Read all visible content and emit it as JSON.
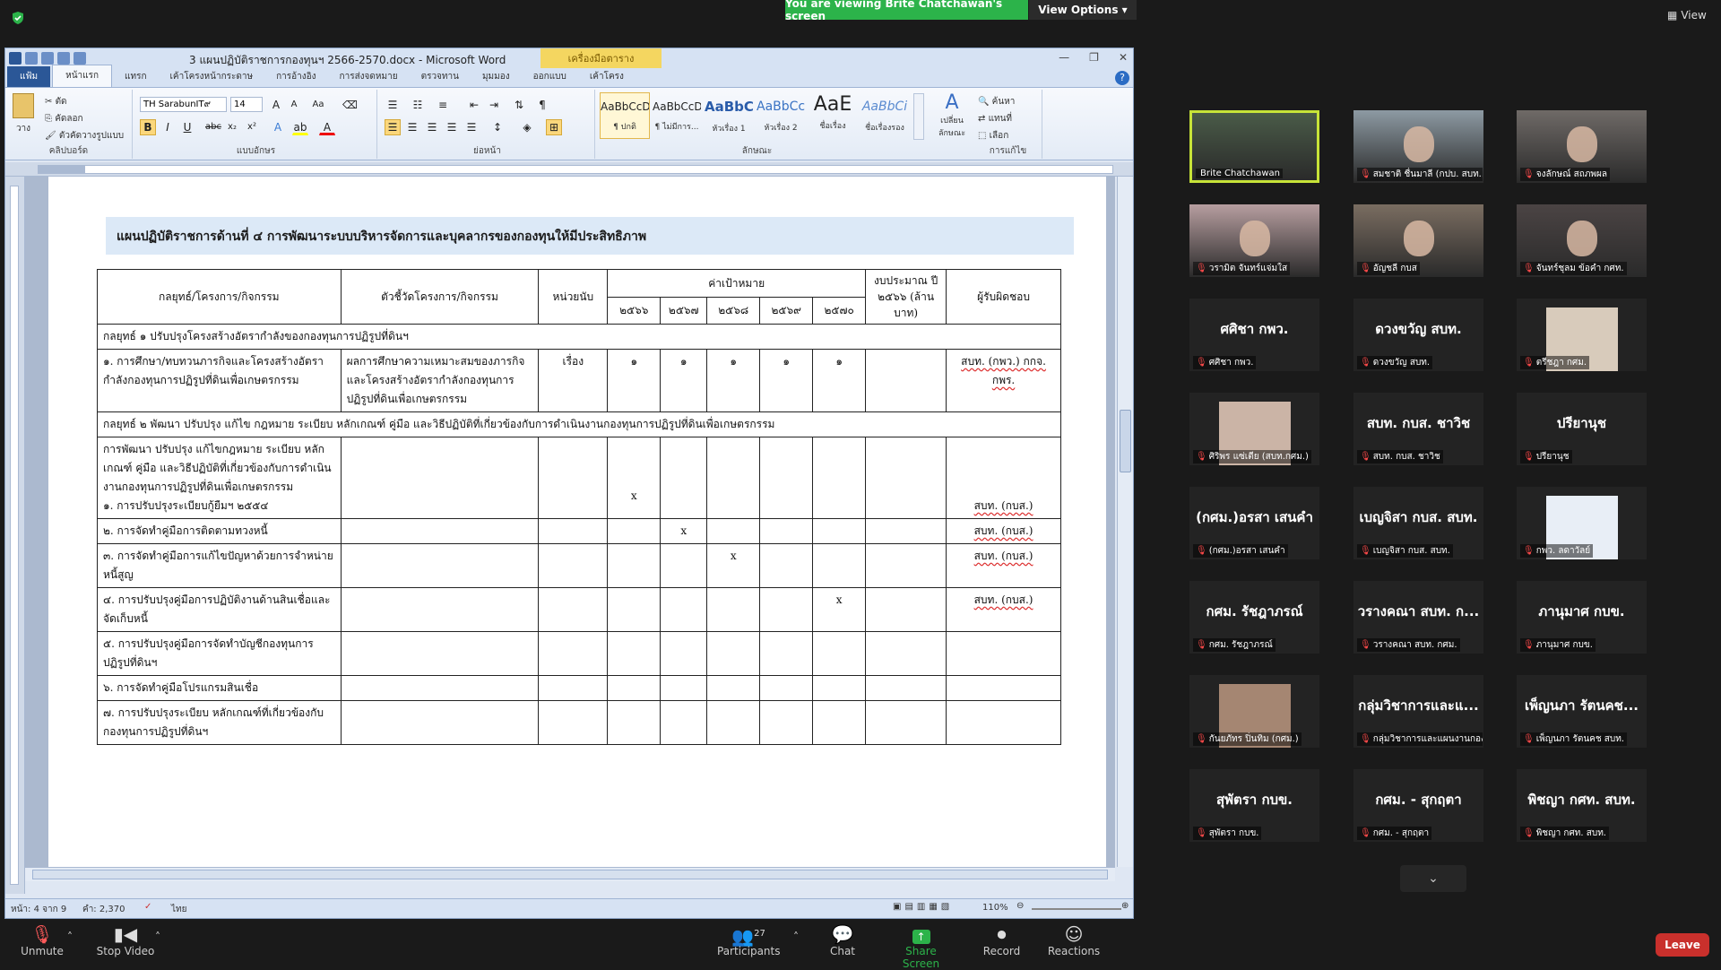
{
  "zoom": {
    "banner": "You are viewing Brite Chatchawan's screen",
    "view_options": "View Options",
    "view": "View"
  },
  "word": {
    "title": "3 แผนปฏิบัติราชการกองทุนฯ 2566-2570.docx - Microsoft Word",
    "tool_tab": "เครื่องมือตาราง",
    "tabs": [
      "แฟ้ม",
      "หน้าแรก",
      "แทรก",
      "เค้าโครงหน้ากระดาษ",
      "การอ้างอิง",
      "การส่งจดหมาย",
      "ตรวจทาน",
      "มุมมอง",
      "ออกแบบ",
      "เค้าโครง"
    ],
    "ribbon": {
      "paste": "วาง",
      "cut": "ตัด",
      "copy": "คัดลอก",
      "format_painter": "ตัวคัดวางรูปแบบ",
      "clipboard": "คลิปบอร์ด",
      "font_name": "TH SarabunIT๙",
      "font_size": "14",
      "font_group": "แบบอักษร",
      "paragraph_group": "ย่อหน้า",
      "styles_group": "ลักษณะ",
      "editing_group": "การแก้ไข",
      "change_styles": "เปลี่ยนลักษณะ",
      "find": "ค้นหา",
      "replace": "แทนที่",
      "select": "เลือก",
      "styles": [
        {
          "sample": "AaBbCcDc",
          "label": "¶ ปกติ"
        },
        {
          "sample": "AaBbCcDc",
          "label": "¶ ไม่มีการ..."
        },
        {
          "sample": "AaBbC",
          "label": "หัวเรื่อง 1"
        },
        {
          "sample": "AaBbCc",
          "label": "หัวเรื่อง 2"
        },
        {
          "sample": "AaE",
          "label": "ชื่อเรื่อง"
        },
        {
          "sample": "AaBbCi",
          "label": "ชื่อเรื่องรอง"
        }
      ]
    },
    "status": {
      "page": "หน้า: 4 จาก 9",
      "words": "คำ: 2,370",
      "lang": "ไทย",
      "zoom": "110%"
    }
  },
  "document": {
    "heading": "แผนปฏิบัติราชการด้านที่ ๔ การพัฒนาระบบบริหารจัดการและบุคลากรของกองทุนให้มีประสิทธิภาพ",
    "headers": {
      "strategy": "กลยุทธ์/โครงการ/กิจกรรม",
      "indicator": "ตัวชี้วัดโครงการ/กิจกรรม",
      "unit": "หน่วยนับ",
      "target": "ค่าเป้าหมาย",
      "years": [
        "๒๕๖๖",
        "๒๕๖๗",
        "๒๕๖๘",
        "๒๕๖๙",
        "๒๕๗๐"
      ],
      "budget": "งบประมาณ ปี ๒๕๖๖ (ล้านบาท)",
      "responsible": "ผู้รับผิดชอบ"
    },
    "strategy1": "กลยุทธ์ ๑ ปรับปรุงโครงสร้างอัตรากำลังของกองทุนการปฏิรูปที่ดินฯ",
    "row1": {
      "activity": "๑. การศึกษา/ทบทวนภารกิจและโครงสร้างอัตรากำลังกองทุนการปฏิรูปที่ดินเพื่อเกษตรกรรม",
      "indicator": "ผลการศึกษาความเหมาะสมของภารกิจและโครงสร้างอัตรากำลังกองทุนการปฏิรูปที่ดินเพื่อเกษตรกรรม",
      "unit": "เรื่อง",
      "targets": [
        "๑",
        "๑",
        "๑",
        "๑",
        "๑"
      ],
      "responsible": "สบท. (กพว.) กกจ. กพร."
    },
    "strategy2": "กลยุทธ์ ๒ พัฒนา ปรับปรุง แก้ไข กฎหมาย ระเบียบ หลักเกณฑ์ คู่มือ และวิธีปฏิบัติที่เกี่ยวข้องกับการดำเนินงานกองทุนการปฏิรูปที่ดินเพื่อเกษตรกรรม",
    "group2_title": "การพัฒนา ปรับปรุง แก้ไขกฎหมาย ระเบียบ หลักเกณฑ์ คู่มือ และวิธีปฏิบัติที่เกี่ยวข้องกับการดำเนินงานกองทุนการปฏิรูปที่ดินเพื่อเกษตรกรรม",
    "rows2": [
      {
        "activity": "๑. การปรับปรุงระเบียบกู้ยืมฯ ๒๕๕๔",
        "mark": "x",
        "year": 0,
        "responsible": "สบท. (กบส.)"
      },
      {
        "activity": "๒. การจัดทำคู่มือการติดตามทวงหนี้",
        "mark": "x",
        "year": 1,
        "responsible": "สบท. (กบส.)"
      },
      {
        "activity": "๓. การจัดทำคู่มือการแก้ไขปัญหาด้วยการจำหน่ายหนี้สูญ",
        "mark": "x",
        "year": 2,
        "responsible": "สบท. (กบส.)"
      },
      {
        "activity": "๔. การปรับปรุงคู่มือการปฏิบัติงานด้านสินเชื่อและจัดเก็บหนี้",
        "mark": "x",
        "year": 4,
        "responsible": "สบท. (กบส.)"
      },
      {
        "activity": "๕. การปรับปรุงคู่มือการจัดทำบัญชีกองทุนการปฏิรูปที่ดินฯ",
        "mark": "",
        "year": -1,
        "responsible": ""
      },
      {
        "activity": "๖. การจัดทำคู่มือโปรแกรมสินเชื่อ",
        "mark": "",
        "year": -1,
        "responsible": ""
      },
      {
        "activity": "๗. การปรับปรุงระเบียบ หลักเกณฑ์ที่เกี่ยวข้องกับกองทุนการปฏิรูปที่ดินฯ",
        "mark": "",
        "year": -1,
        "responsible": ""
      }
    ]
  },
  "participants": [
    {
      "big": "",
      "label": "Brite Chatchawan",
      "video": true,
      "muted": false,
      "active": true,
      "bg": "#4a5b48"
    },
    {
      "big": "",
      "label": "สมชาติ ชื่นมาลี (กปบ. สบท...",
      "video": true,
      "muted": true,
      "active": false,
      "bg": "#8d9aa3"
    },
    {
      "big": "",
      "label": "จงลักษณ์ สถภพผล",
      "video": true,
      "muted": true,
      "active": false,
      "bg": "#6f6a67"
    },
    {
      "big": "",
      "label": "วรามิต จันทร์แจ่มใส",
      "video": true,
      "muted": true,
      "active": false,
      "bg": "#b79ea0"
    },
    {
      "big": "",
      "label": "อัญชลี กบส",
      "video": true,
      "muted": true,
      "active": false,
      "bg": "#7a6d61"
    },
    {
      "big": "",
      "label": "จันทร์ชุลม ข้อคำ กศท.",
      "video": true,
      "muted": true,
      "active": false,
      "bg": "#4b4444"
    },
    {
      "big": "ศศิชา กพว.",
      "label": "ศศิชา กพว.",
      "video": false,
      "muted": true,
      "active": false,
      "bg": ""
    },
    {
      "big": "ดวงขวัญ สบท.",
      "label": "ดวงขวัญ สบท.",
      "video": false,
      "muted": true,
      "active": false,
      "bg": ""
    },
    {
      "big": "",
      "label": "ตรีชฎา กศม.",
      "video": false,
      "muted": true,
      "active": false,
      "bg": "",
      "thumb": "#d8cbbb"
    },
    {
      "big": "",
      "label": "ศิริพร แซ่เตีย (สบท.กศม.)",
      "video": false,
      "muted": true,
      "active": false,
      "bg": "",
      "thumb": "#cbb4a6"
    },
    {
      "big": "สบท. กบส. ชาวิช",
      "label": "สบท. กบส. ชาวิช",
      "video": false,
      "muted": true,
      "active": false,
      "bg": ""
    },
    {
      "big": "ปรียานุช",
      "label": "ปรียานุช",
      "video": false,
      "muted": true,
      "active": false,
      "bg": ""
    },
    {
      "big": "(กศม.)อรสา เสนคำ",
      "label": "(กศม.)อรสา เสนคำ",
      "video": false,
      "muted": true,
      "active": false,
      "bg": ""
    },
    {
      "big": "เบญจิสา กบส. สบท.",
      "label": "เบญจิสา กบส. สบท.",
      "video": false,
      "muted": true,
      "active": false,
      "bg": ""
    },
    {
      "big": "",
      "label": "กพว. ลดาวัลย์",
      "video": false,
      "muted": true,
      "active": false,
      "bg": "",
      "thumb": "#e8eef6"
    },
    {
      "big": "กศม. รัชฎาภรณ์",
      "label": "กศม. รัชฎาภรณ์",
      "video": false,
      "muted": true,
      "active": false,
      "bg": ""
    },
    {
      "big": "วรางคณา สบท. ก...",
      "label": "วรางคณา สบท. กศม.",
      "video": false,
      "muted": true,
      "active": false,
      "bg": ""
    },
    {
      "big": "ภานุมาศ กบข.",
      "label": "ภานุมาศ กบข.",
      "video": false,
      "muted": true,
      "active": false,
      "bg": ""
    },
    {
      "big": "",
      "label": "กันยภัทร ปิ่นทิม (กศม.)",
      "video": false,
      "muted": true,
      "active": false,
      "bg": "",
      "thumb": "#a58672"
    },
    {
      "big": "กลุ่มวิชาการและแ...",
      "label": "กลุ่มวิชาการและแผนงานกอง...",
      "video": false,
      "muted": true,
      "active": false,
      "bg": ""
    },
    {
      "big": "เพ็ญนภา รัตนคช...",
      "label": "เพ็ญนภา รัตนคช สบท.",
      "video": false,
      "muted": true,
      "active": false,
      "bg": ""
    },
    {
      "big": "สุพัตรา กบข.",
      "label": "สุพัตรา กบข.",
      "video": false,
      "muted": true,
      "active": false,
      "bg": ""
    },
    {
      "big": "กศม. - สุกฤตา",
      "label": "กศม. - สุกฤตา",
      "video": false,
      "muted": true,
      "active": false,
      "bg": ""
    },
    {
      "big": "พิชญา กศท. สบท.",
      "label": "พิชญา กศท. สบท.",
      "video": false,
      "muted": true,
      "active": false,
      "bg": ""
    }
  ],
  "toolbar": {
    "unmute": "Unmute",
    "stop_video": "Stop Video",
    "participants": "Participants",
    "participants_count": "27",
    "chat": "Chat",
    "share": "Share Screen",
    "record": "Record",
    "reactions": "Reactions",
    "leave": "Leave"
  },
  "colors": {
    "share_green": "#2cb34a",
    "leave_red": "#c9302c",
    "active_border": "#c7e338",
    "heading_bg": "#dce9f7"
  }
}
